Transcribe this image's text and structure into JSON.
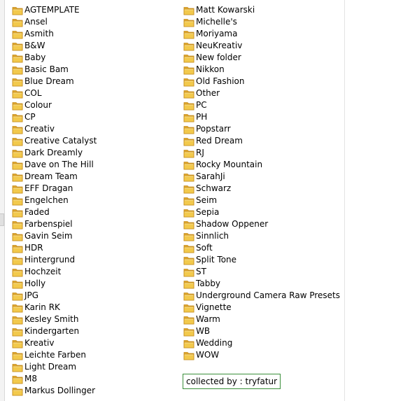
{
  "folders_left": [
    {
      "label": "AGTEMPLATE",
      "icon": "folder-icon"
    },
    {
      "label": "Ansel",
      "icon": "folder-icon"
    },
    {
      "label": "Asmith",
      "icon": "folder-icon"
    },
    {
      "label": "B&W",
      "icon": "folder-icon"
    },
    {
      "label": "Baby",
      "icon": "folder-icon"
    },
    {
      "label": "Basic Bam",
      "icon": "folder-icon"
    },
    {
      "label": "Blue Dream",
      "icon": "folder-icon"
    },
    {
      "label": "COL",
      "icon": "folder-icon"
    },
    {
      "label": "Colour",
      "icon": "folder-icon"
    },
    {
      "label": "CP",
      "icon": "folder-icon"
    },
    {
      "label": "Creativ",
      "icon": "folder-icon"
    },
    {
      "label": "Creative Catalyst",
      "icon": "folder-icon"
    },
    {
      "label": "Dark Dreamly",
      "icon": "folder-icon"
    },
    {
      "label": "Dave on The Hill",
      "icon": "folder-icon"
    },
    {
      "label": "Dream Team",
      "icon": "folder-icon"
    },
    {
      "label": "EFF Dragan",
      "icon": "folder-icon"
    },
    {
      "label": "Engelchen",
      "icon": "folder-icon"
    },
    {
      "label": "Faded",
      "icon": "folder-icon"
    },
    {
      "label": "Farbenspiel",
      "icon": "folder-icon"
    },
    {
      "label": "Gavin Seim",
      "icon": "folder-icon"
    },
    {
      "label": "HDR",
      "icon": "folder-icon"
    },
    {
      "label": "Hintergrund",
      "icon": "folder-icon"
    },
    {
      "label": "Hochzeit",
      "icon": "folder-icon"
    },
    {
      "label": "Holly",
      "icon": "folder-icon"
    },
    {
      "label": "JPG",
      "icon": "folder-icon"
    },
    {
      "label": "Karin RK",
      "icon": "folder-icon"
    },
    {
      "label": "Kesley Smith",
      "icon": "folder-icon"
    },
    {
      "label": "Kindergarten",
      "icon": "folder-icon"
    },
    {
      "label": "Kreativ",
      "icon": "folder-icon"
    },
    {
      "label": "Leichte Farben",
      "icon": "folder-icon"
    },
    {
      "label": "Light Dream",
      "icon": "folder-icon"
    },
    {
      "label": "M8",
      "icon": "folder-icon"
    },
    {
      "label": "Markus Dollinger",
      "icon": "folder-icon"
    }
  ],
  "folders_right": [
    {
      "label": "Matt Kowarski",
      "icon": "folder-icon"
    },
    {
      "label": "Michelle's",
      "icon": "folder-icon"
    },
    {
      "label": "Moriyama",
      "icon": "folder-icon"
    },
    {
      "label": "NeuKreativ",
      "icon": "folder-icon"
    },
    {
      "label": "New folder",
      "icon": "folder-icon"
    },
    {
      "label": "Nikkon",
      "icon": "folder-icon"
    },
    {
      "label": "Old Fashion",
      "icon": "folder-icon"
    },
    {
      "label": "Other",
      "icon": "folder-icon"
    },
    {
      "label": "PC",
      "icon": "folder-icon"
    },
    {
      "label": "PH",
      "icon": "folder-icon"
    },
    {
      "label": "Popstarr",
      "icon": "folder-icon"
    },
    {
      "label": "Red Dream",
      "icon": "folder-icon"
    },
    {
      "label": "RJ",
      "icon": "folder-icon"
    },
    {
      "label": "Rocky Mountain",
      "icon": "folder-icon"
    },
    {
      "label": "SarahJi",
      "icon": "folder-icon"
    },
    {
      "label": "Schwarz",
      "icon": "folder-icon"
    },
    {
      "label": "Seim",
      "icon": "folder-icon"
    },
    {
      "label": "Sepia",
      "icon": "folder-icon"
    },
    {
      "label": "Shadow Oppener",
      "icon": "folder-icon"
    },
    {
      "label": "Sinnlich",
      "icon": "folder-icon"
    },
    {
      "label": "Soft",
      "icon": "folder-icon"
    },
    {
      "label": "Split Tone",
      "icon": "folder-icon"
    },
    {
      "label": "ST",
      "icon": "folder-icon"
    },
    {
      "label": "Tabby",
      "icon": "folder-icon"
    },
    {
      "label": "Underground Camera Raw Presets",
      "icon": "folder-icon"
    },
    {
      "label": "Vignette",
      "icon": "folder-icon"
    },
    {
      "label": "Warm",
      "icon": "folder-icon"
    },
    {
      "label": "WB",
      "icon": "folder-icon"
    },
    {
      "label": "Wedding",
      "icon": "folder-icon"
    },
    {
      "label": "WOW",
      "icon": "folder-icon"
    }
  ],
  "credit": {
    "text": "collected by : tryfatur",
    "border_color": "#3a8f3a"
  },
  "colors": {
    "folder_body": "#f2c94c",
    "folder_tab": "#e0a82e",
    "folder_edge": "#c48a1c"
  }
}
